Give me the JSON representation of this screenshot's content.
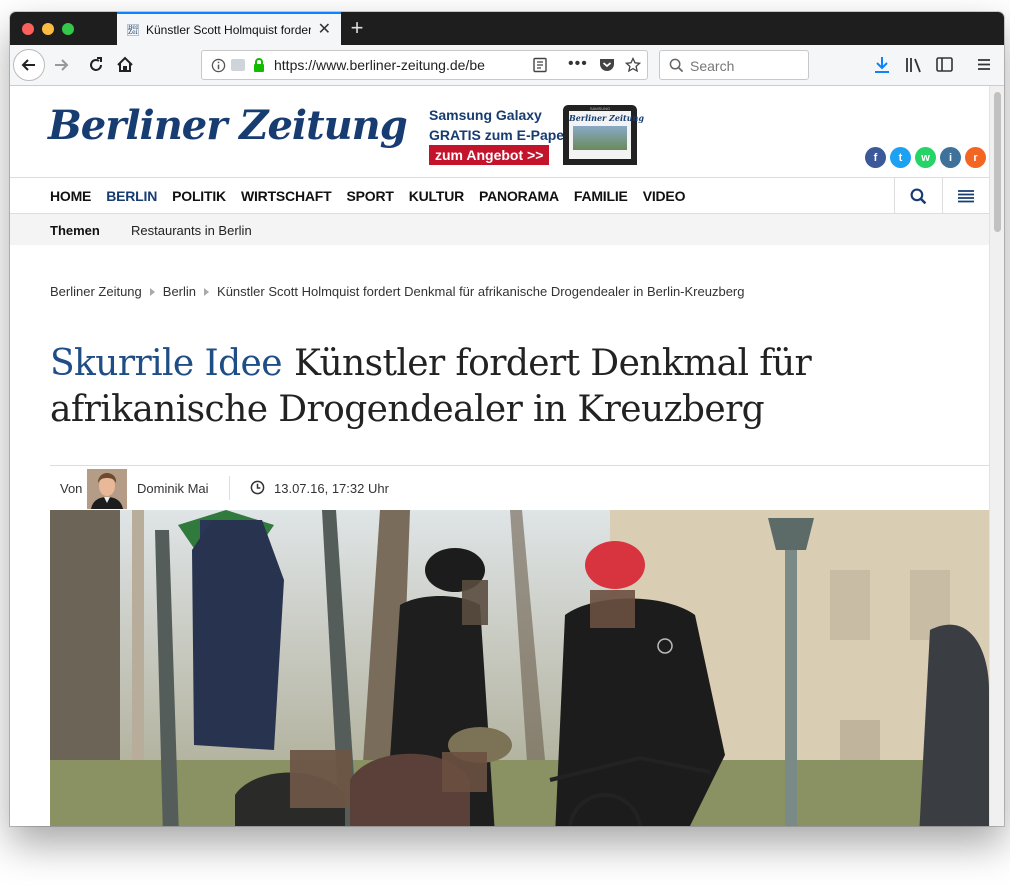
{
  "browser": {
    "tab_title": "Künstler Scott Holmquist fordert Denkmal",
    "favicon_text": "Berliner Zeitung",
    "new_tab": "+",
    "url": "https://www.berliner-zeitung.de/be",
    "search_placeholder": "Search",
    "icons": [
      "back-icon",
      "forward-icon",
      "reload-icon",
      "home-icon",
      "info-icon",
      "lock-icon",
      "reader-icon",
      "more-icon",
      "pocket-icon",
      "bookmark-star-icon",
      "search-icon",
      "download-icon",
      "library-icon",
      "sidebar-icon",
      "menu-icon"
    ]
  },
  "site": {
    "logo": "Berliner Zeitung",
    "ad": {
      "line1": "Samsung Galaxy",
      "line2": "GRATIS zum E-Paper",
      "button": "zum Angebot >>",
      "tablet_brand": "SAMSUNG",
      "tablet_masthead": "Berliner Zeitung"
    },
    "social": [
      "f",
      "t",
      "w",
      "i",
      "r"
    ],
    "nav": [
      "HOME",
      "BERLIN",
      "POLITIK",
      "WIRTSCHAFT",
      "SPORT",
      "KULTUR",
      "PANORAMA",
      "FAMILIE",
      "VIDEO"
    ],
    "nav_active": "BERLIN",
    "themen_label": "Themen",
    "themen_link": "Restaurants in Berlin",
    "brand_color": "#173c71",
    "accent_color": "#c4142c"
  },
  "article": {
    "breadcrumb": [
      "Berliner Zeitung",
      "Berlin",
      "Künstler Scott Holmquist fordert Denkmal für afrikanische Drogendealer in Berlin-Kreuzberg"
    ],
    "kicker": "Skurrile Idee",
    "title": "Künstler fordert Denkmal für afrikanische Drogendealer in Kreuzberg",
    "byline_prefix": "Von",
    "author": "Dominik Mai",
    "date": "13.07.16, 17:32 Uhr"
  }
}
